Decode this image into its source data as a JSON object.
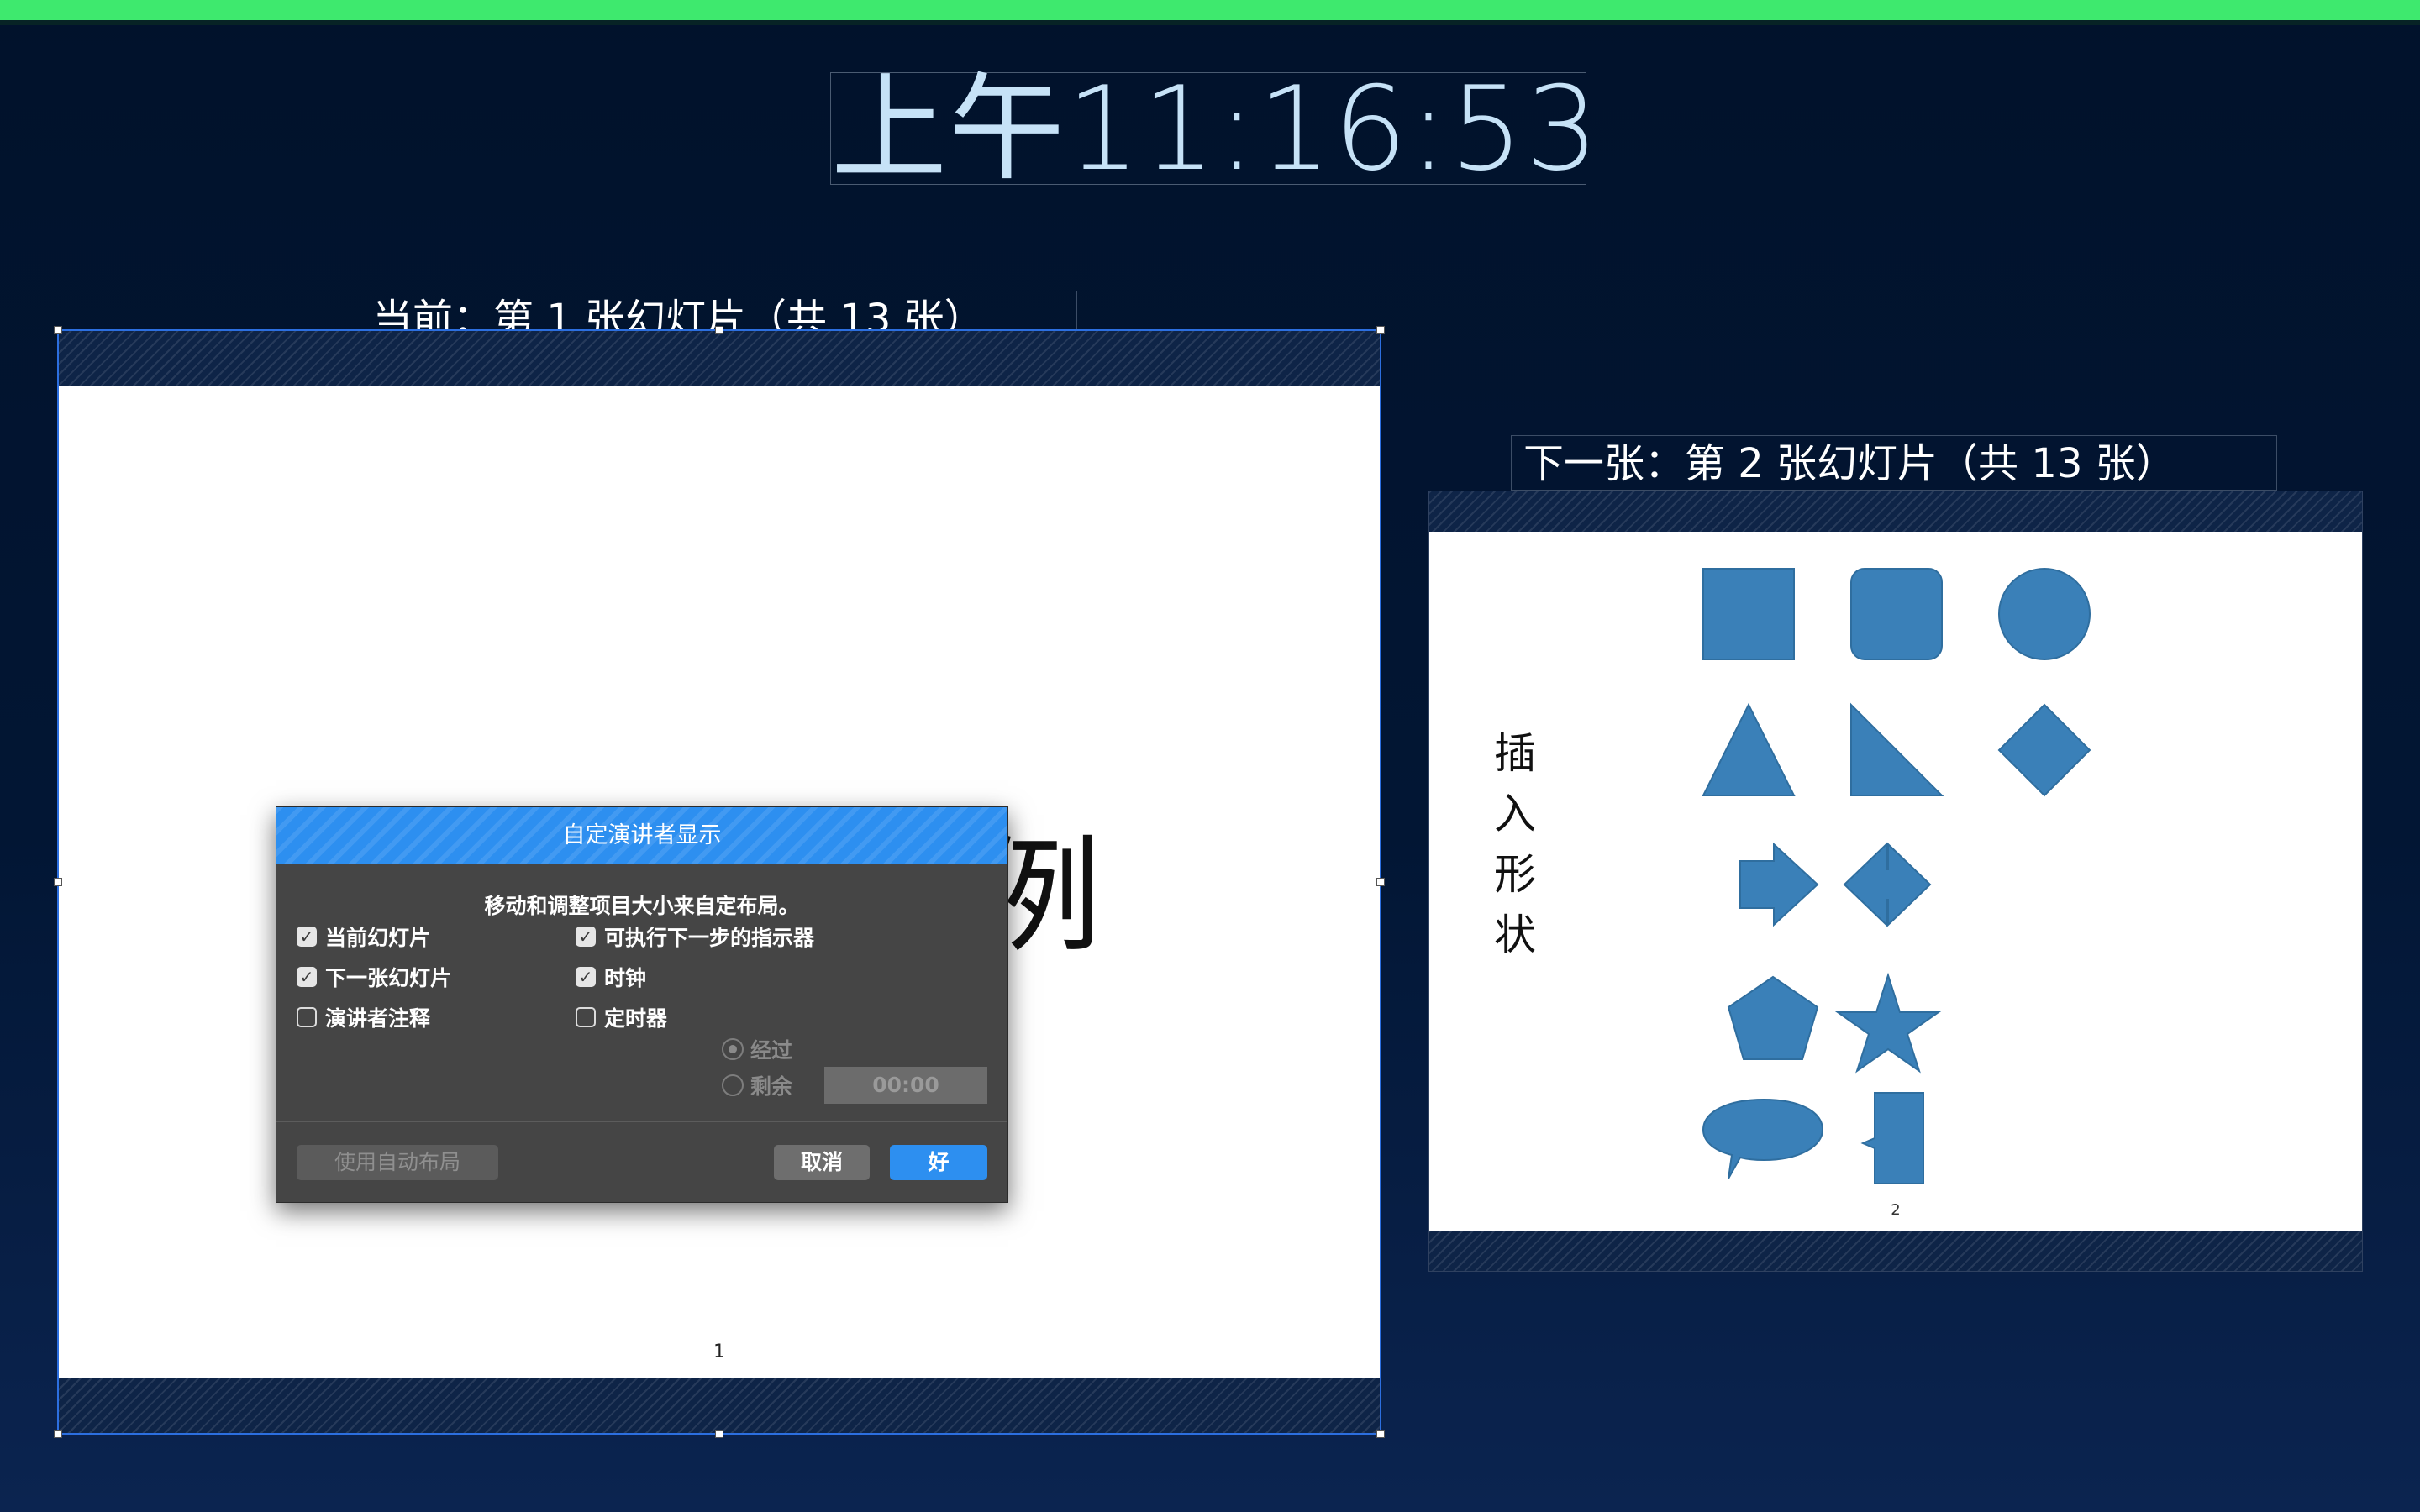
{
  "clock": {
    "time": "上午11:16:53"
  },
  "current": {
    "label": "当前：第 1 张幻灯片（共 13 张）",
    "slide_title": "Keynote示例",
    "slide_number": "1"
  },
  "next": {
    "label": "下一张：第 2 张幻灯片（共 13 张）",
    "slide_title": "插入形状",
    "slide_number": "2",
    "shape_color": "#3a80b8",
    "shapes": [
      "square",
      "rounded-square",
      "circle",
      "triangle",
      "right-triangle",
      "diamond",
      "arrow",
      "double-arrow",
      "pentagon",
      "star",
      "speech-bubble",
      "callout-square"
    ]
  },
  "dialog": {
    "title": "自定演讲者显示",
    "message": "移动和调整项目大小来自定布局。",
    "options": {
      "current_slide": {
        "label": "当前幻灯片",
        "checked": true
      },
      "next_slide": {
        "label": "下一张幻灯片",
        "checked": true
      },
      "presenter_notes": {
        "label": "演讲者注释",
        "checked": false
      },
      "ready_indicator": {
        "label": "可执行下一步的指示器",
        "checked": true
      },
      "clock": {
        "label": "时钟",
        "checked": true
      },
      "timer": {
        "label": "定时器",
        "checked": false
      }
    },
    "timer_mode": {
      "elapsed": "经过",
      "remaining": "剩余",
      "selected": "elapsed"
    },
    "timer_value": "00:00",
    "buttons": {
      "auto_layout": "使用自动布局",
      "cancel": "取消",
      "ok": "好"
    }
  },
  "colors": {
    "top_bar": "#3ee96e",
    "accent": "#2d8ff0",
    "background": "#021634"
  }
}
